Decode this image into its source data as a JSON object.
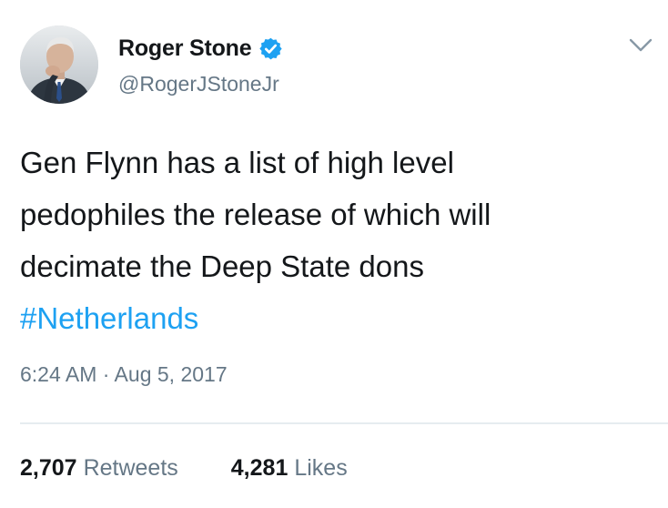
{
  "author": {
    "display_name": "Roger Stone",
    "handle": "@RogerJStoneJr",
    "verified": true
  },
  "tweet": {
    "lines": [
      "Gen Flynn has a list of high level",
      "pedophiles the release of which will",
      "decimate the Deep State dons"
    ],
    "hashtag": "#Netherlands",
    "timestamp": "6:24 AM · Aug 5, 2017"
  },
  "stats": {
    "retweets_count": "2,707",
    "retweets_label": "Retweets",
    "likes_count": "4,281",
    "likes_label": "Likes"
  },
  "icons": {
    "verified": "verified-badge-icon",
    "menu": "chevron-down-icon"
  },
  "colors": {
    "accent": "#1da1f2",
    "secondary_text": "#657786",
    "primary_text": "#14171a"
  }
}
